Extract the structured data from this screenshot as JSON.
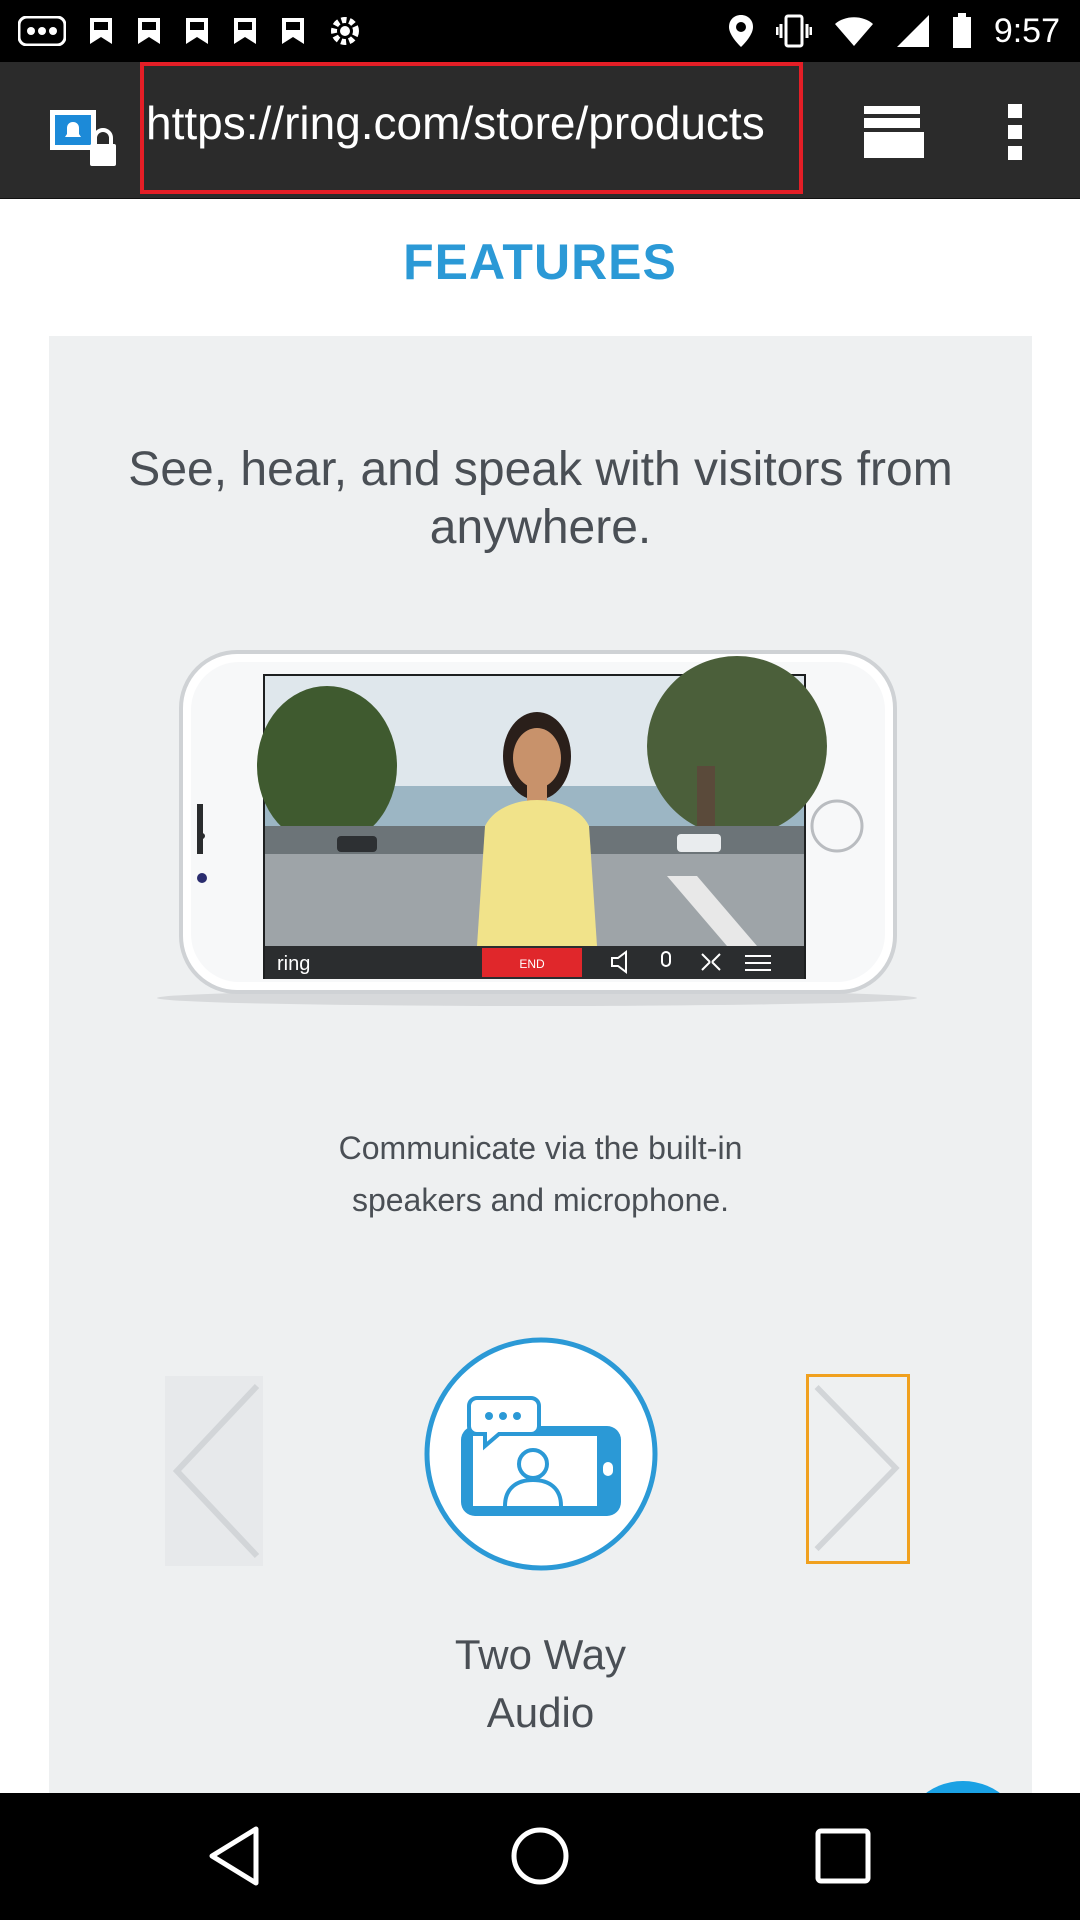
{
  "status_bar": {
    "time": "9:57",
    "left_icons": [
      "more-dots-icon",
      "bookmark-icon",
      "bookmark-icon",
      "bookmark-icon",
      "bookmark-icon",
      "bookmark-icon",
      "settings-icon"
    ],
    "right_icons": [
      "location-icon",
      "vibrate-icon",
      "wifi-icon",
      "signal-icon",
      "battery-icon"
    ]
  },
  "browser": {
    "url": "https://ring.com/store/products",
    "accent_highlight": "#e41e26"
  },
  "page": {
    "section_title": "FEATURES",
    "headline": "See, hear, and speak with visitors from anywhere.",
    "phone_screen": {
      "app_label": "ring",
      "end_button": "END"
    },
    "subtext": "Communicate via the built-in speakers and microphone.",
    "feature_label": "Two Way Audio",
    "colors": {
      "title": "#2b99d6",
      "help_button": "#1aa1e4",
      "next_arrow_border": "#f0a01e"
    }
  },
  "nav_bar": {
    "buttons": [
      "back-icon",
      "home-icon",
      "recents-icon"
    ]
  }
}
